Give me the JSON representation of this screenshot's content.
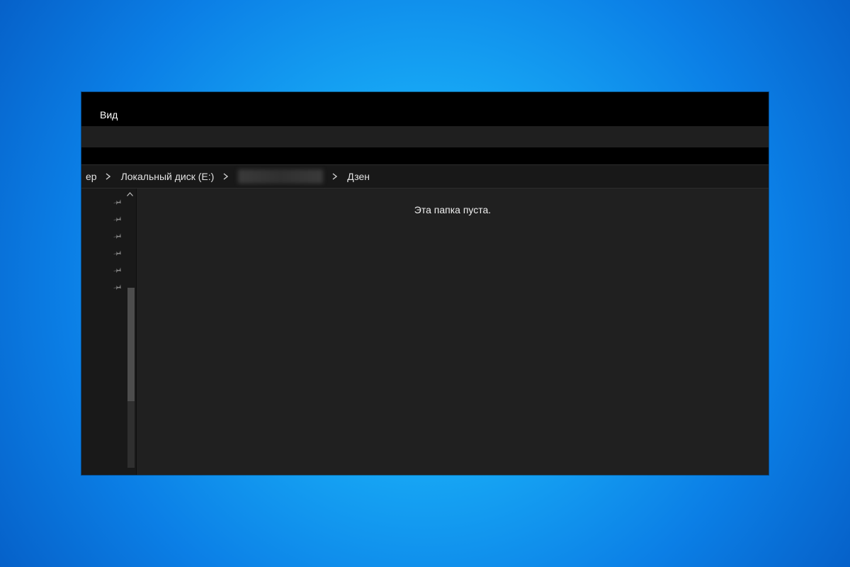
{
  "ribbon": {
    "tab_view": "Вид"
  },
  "breadcrumb": {
    "clipped_fragment": "ер",
    "drive": "Локальный диск (E:)",
    "redacted": "",
    "folder": "Дзен"
  },
  "content": {
    "empty_message": "Эта папка пуста."
  },
  "icons": {
    "pin": "pin-icon",
    "chevron": "chevron-right-icon",
    "scroll_up": "scroll-up-icon"
  }
}
